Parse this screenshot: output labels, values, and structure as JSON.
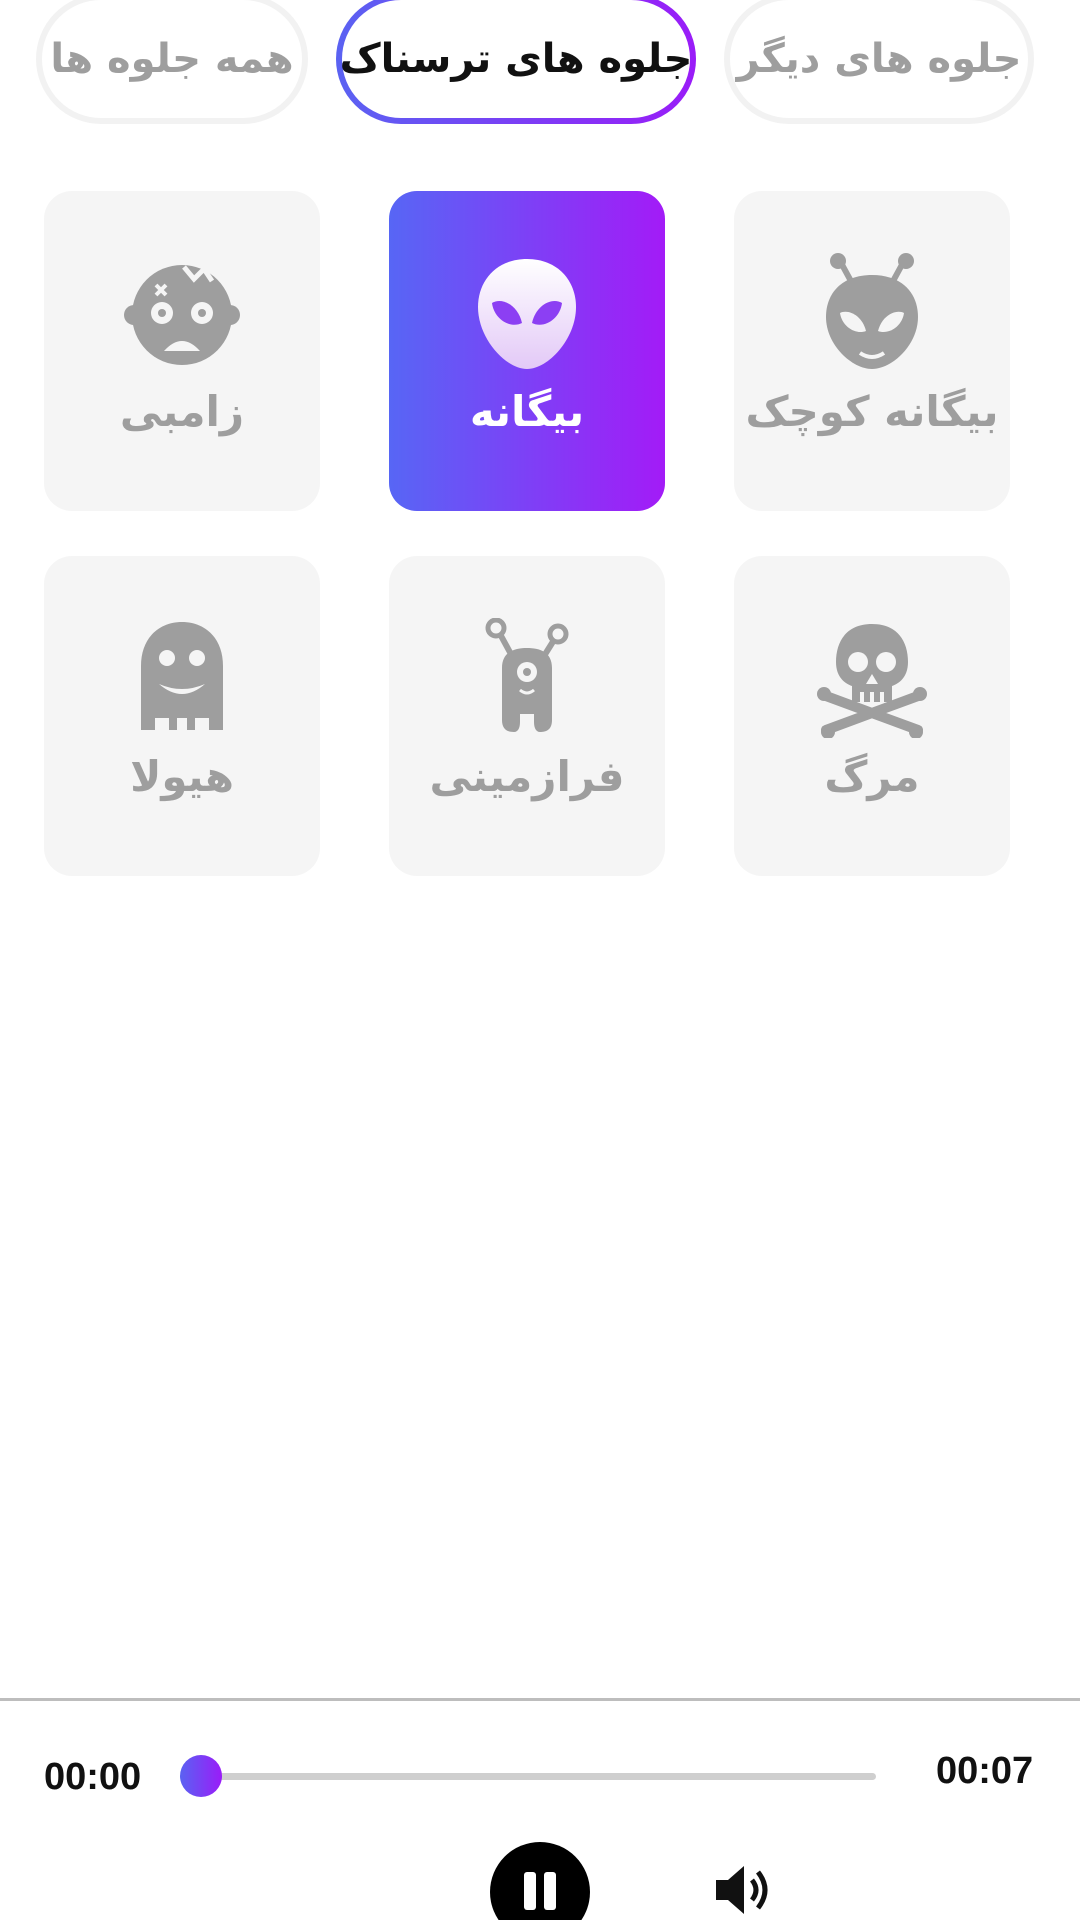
{
  "tabs": [
    {
      "label": "جلوه های دیگر",
      "active": false
    },
    {
      "label": "جلوه های ترسناک",
      "active": true
    },
    {
      "label": "همه جلوه ها",
      "active": false
    }
  ],
  "effects": [
    {
      "label": "بیگانه کوچک",
      "icon": "small-alien-icon",
      "selected": false
    },
    {
      "label": "بیگانه",
      "icon": "alien-icon",
      "selected": true
    },
    {
      "label": "زامبی",
      "icon": "zombie-icon",
      "selected": false
    },
    {
      "label": "مرگ",
      "icon": "skull-crossbones-icon",
      "selected": false
    },
    {
      "label": "فرازمینی",
      "icon": "extraterrestrial-icon",
      "selected": false
    },
    {
      "label": "هیولا",
      "icon": "monster-icon",
      "selected": false
    }
  ],
  "player": {
    "current_time": "00:00",
    "total_time": "00:07",
    "progress": 0,
    "state_icon": "pause-icon",
    "volume_icon": "volume-icon"
  },
  "colors": {
    "accent_start": "#5766f5",
    "accent_end": "#a31bf7",
    "card_bg": "#f5f5f5",
    "inactive_text": "#9e9e9e"
  }
}
